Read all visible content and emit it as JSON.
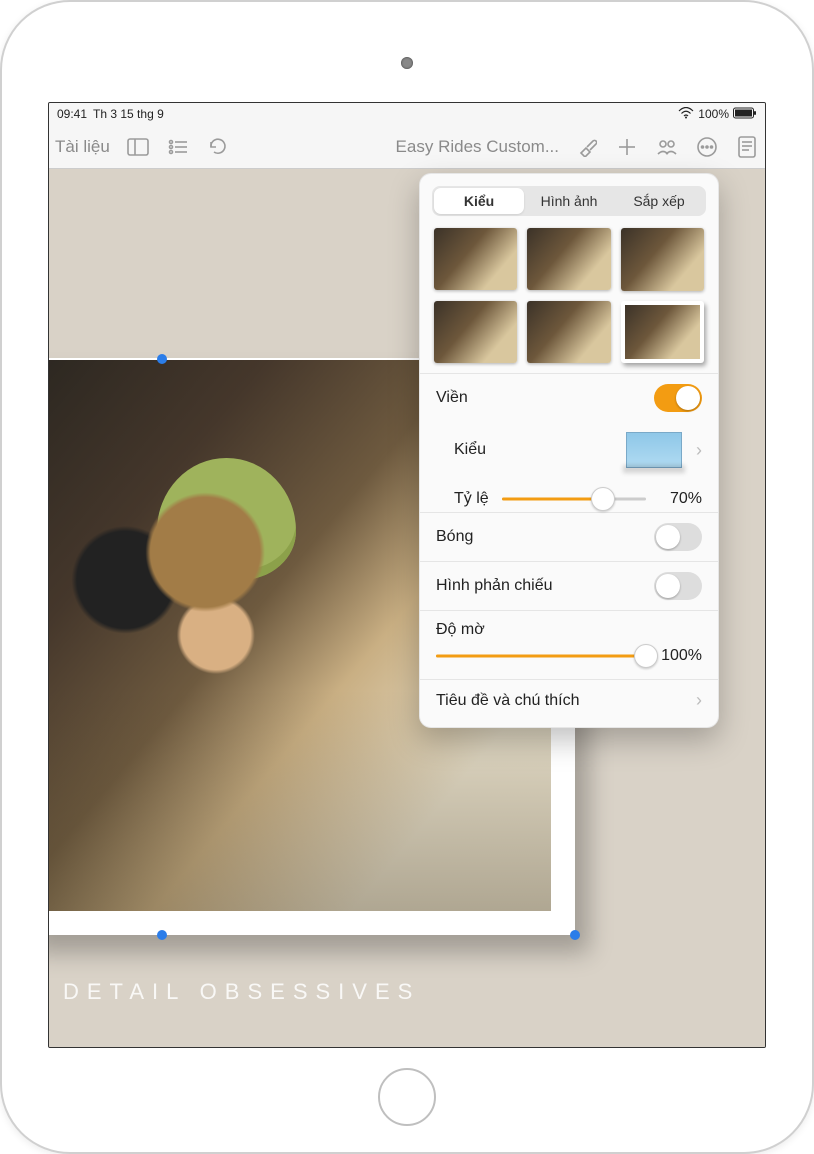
{
  "status": {
    "time": "09:41",
    "date": "Th 3 15 thg 9",
    "battery": "100%"
  },
  "toolbar": {
    "back_label": "Tài liệu",
    "doc_title": "Easy Rides Custom..."
  },
  "canvas": {
    "caption": "DETAIL OBSESSIVES"
  },
  "popover": {
    "tabs": {
      "style": "Kiểu",
      "image": "Hình ảnh",
      "arrange": "Sắp xếp"
    },
    "border": {
      "label": "Viền",
      "enabled": true,
      "style_label": "Kiểu",
      "scale_label": "Tỷ lệ",
      "scale_value": "70%",
      "scale_pct": 70
    },
    "shadow": {
      "label": "Bóng",
      "enabled": false
    },
    "reflection": {
      "label": "Hình phản chiếu",
      "enabled": false
    },
    "opacity": {
      "label": "Độ mờ",
      "value": "100%",
      "pct": 100
    },
    "title_caption": {
      "label": "Tiêu đề và chú thích"
    }
  }
}
